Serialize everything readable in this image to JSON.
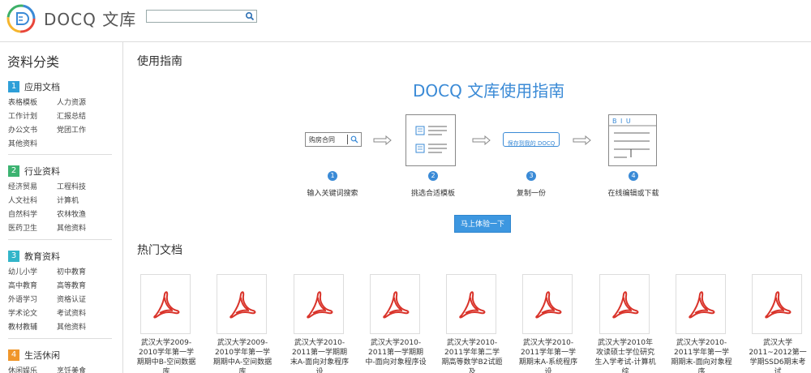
{
  "header": {
    "brand": "DOCQ 文库",
    "search": {
      "value": "",
      "placeholder": ""
    },
    "icons": {
      "logo": "docq-logo-icon",
      "search": "search-icon"
    }
  },
  "sidebar": {
    "title": "资料分类",
    "categories": [
      {
        "num": "1",
        "name": "应用文档",
        "color": "#2e9fd8",
        "items": [
          "表格模板",
          "人力资源",
          "工作计划",
          "汇报总结",
          "办公文书",
          "党团工作",
          "其他资料"
        ]
      },
      {
        "num": "2",
        "name": "行业资料",
        "color": "#3cb371",
        "items": [
          "经济贸易",
          "工程科技",
          "人文社科",
          "计算机",
          "自然科学",
          "农林牧渔",
          "医药卫生",
          "其他资料"
        ]
      },
      {
        "num": "3",
        "name": "教育资料",
        "color": "#33b5c9",
        "items": [
          "幼儿小学",
          "初中教育",
          "高中教育",
          "高等教育",
          "外语学习",
          "资格认证",
          "学术论文",
          "考试资料",
          "教材教辅",
          "其他资料"
        ]
      },
      {
        "num": "4",
        "name": "生活休闲",
        "color": "#f0962a",
        "items": [
          "休闲娱乐",
          "烹饪美食"
        ]
      }
    ]
  },
  "main": {
    "guide_section_title": "使用指南",
    "guide_title": "DOCQ 文库使用指南",
    "steps": [
      {
        "num": "1",
        "label": "输入关键词搜索",
        "art_text": "购房合同"
      },
      {
        "num": "2",
        "label": "挑选合适模板"
      },
      {
        "num": "3",
        "label": "复制一份",
        "art_text": "保存到我的 DOCQ"
      },
      {
        "num": "4",
        "label": "在线编辑或下载",
        "art_text": "B I U"
      }
    ],
    "cta_label": "马上体验一下",
    "hot_section_title": "热门文档",
    "docs": [
      {
        "title": "武汉大学2009-2010学年第一学期期中B-空间数据库",
        "icon": "pdf-icon"
      },
      {
        "title": "武汉大学2009-2010学年第一学期期中A-空间数据库",
        "icon": "pdf-icon"
      },
      {
        "title": "武汉大学2010-2011第一学期期末A-面向对象程序设",
        "icon": "pdf-icon"
      },
      {
        "title": "武汉大学2010-2011第一学期期中-面向对象程序设",
        "icon": "pdf-icon"
      },
      {
        "title": "武汉大学2010-2011学年第二学期高等数学B2试题及",
        "icon": "pdf-icon"
      },
      {
        "title": "武汉大学2010-2011学年第一学期期末A-系统程序设",
        "icon": "pdf-icon"
      },
      {
        "title": "武汉大学2010年攻读硕士学位研究生入学考试-计算机综",
        "icon": "pdf-icon"
      },
      {
        "title": "武汉大学2010-2011学年第一学期期末-面向对象程序",
        "icon": "pdf-icon"
      },
      {
        "title": "武汉大学2011~2012第一学期SSD6期末考试",
        "icon": "pdf-icon"
      }
    ]
  }
}
